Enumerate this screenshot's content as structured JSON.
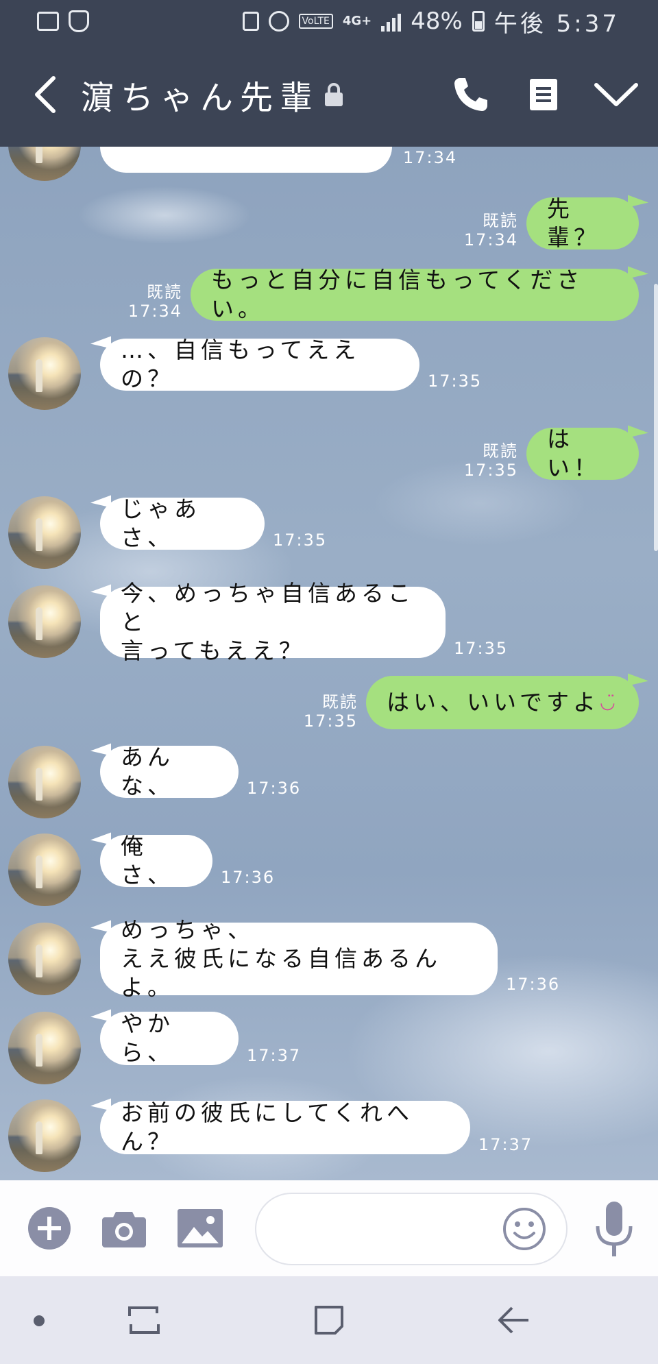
{
  "status_bar": {
    "battery": "48%",
    "clock": "午後 5:37",
    "network": "4G+",
    "volte": "VoLTE"
  },
  "header": {
    "title": "濵ちゃん先輩"
  },
  "messages": [
    {
      "side": "recv",
      "text": "",
      "time": "17:34"
    },
    {
      "side": "sent",
      "text": "先輩？",
      "read": "既読",
      "time": "17:34"
    },
    {
      "side": "sent",
      "text": "もっと自分に自信もってください。",
      "read": "既読",
      "time": "17:34"
    },
    {
      "side": "recv",
      "text": "…、自信もってええの？",
      "time": "17:35"
    },
    {
      "side": "sent",
      "text": "はい！",
      "read": "既読",
      "time": "17:35"
    },
    {
      "side": "recv",
      "text": "じゃあさ、",
      "time": "17:35"
    },
    {
      "side": "recv",
      "text": "今、めっちゃ自信あること\n言ってもええ？",
      "time": "17:35"
    },
    {
      "side": "sent",
      "text": "はい、いいですよ",
      "emoji": "◡̈",
      "read": "既読",
      "time": "17:35"
    },
    {
      "side": "recv",
      "text": "あんな、",
      "time": "17:36"
    },
    {
      "side": "recv",
      "text": "俺さ、",
      "time": "17:36"
    },
    {
      "side": "recv",
      "text": "めっちゃ、\nええ彼氏になる自信あるんよ。",
      "time": "17:36"
    },
    {
      "side": "recv",
      "text": "やから、",
      "time": "17:37"
    },
    {
      "side": "recv",
      "text": "お前の彼氏にしてくれへん？",
      "time": "17:37"
    }
  ],
  "input": {
    "placeholder": ""
  },
  "icons": {
    "back": "chevron-left-icon",
    "call": "phone-icon",
    "menu": "menu-icon",
    "collapse": "chevron-down-icon"
  },
  "colors": {
    "header_bg": "#3c4455",
    "sent_bubble": "#a5e07f",
    "recv_bubble": "#ffffff",
    "icon_gray": "#8a8ea6"
  }
}
